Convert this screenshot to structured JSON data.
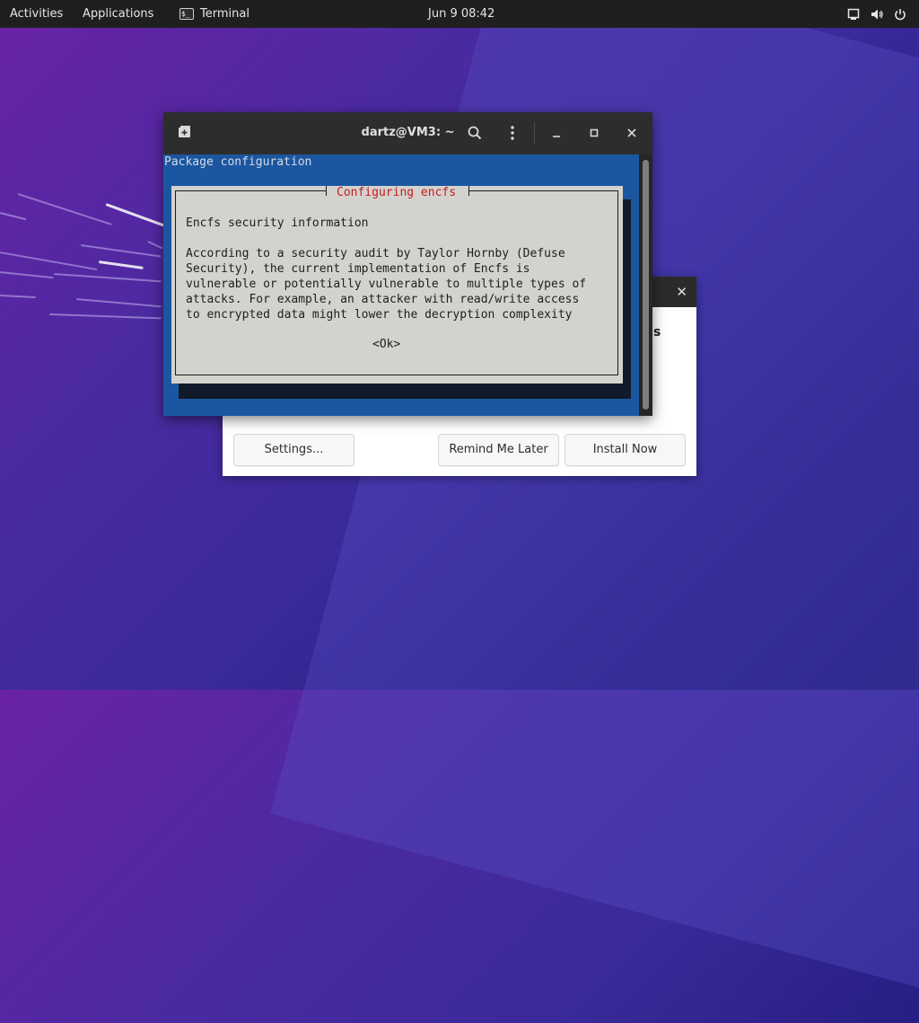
{
  "topbar": {
    "activities": "Activities",
    "applications": "Applications",
    "active_app": "Terminal",
    "active_app_icon": "terminal-icon",
    "clock": "Jun 9  08:42",
    "status_icons": [
      "network-icon",
      "volume-icon",
      "power-icon"
    ]
  },
  "terminal": {
    "title": "dartz@VM3: ~",
    "package_config": "Package configuration",
    "dialog": {
      "title": "Configuring encfs",
      "heading": "Encfs security information",
      "lines": [
        "According to a security audit by Taylor Hornby (Defuse",
        "Security), the current implementation of Encfs is",
        "vulnerable or potentially vulnerable to multiple types of",
        "attacks. For example, an attacker with read/write access",
        "to encrypted data might lower the decryption complexity"
      ],
      "ok_label": "<Ok>"
    }
  },
  "update_dialog": {
    "peek_text": "s",
    "settings_label": "Settings...",
    "remind_label": "Remind Me Later",
    "install_label": "Install Now"
  },
  "colors": {
    "terminal_bg": "#1b57a0",
    "dialog_bg": "#d4d2ce",
    "dialog_title": "#c41d1d",
    "topbar_bg": "#1f1f1f"
  }
}
